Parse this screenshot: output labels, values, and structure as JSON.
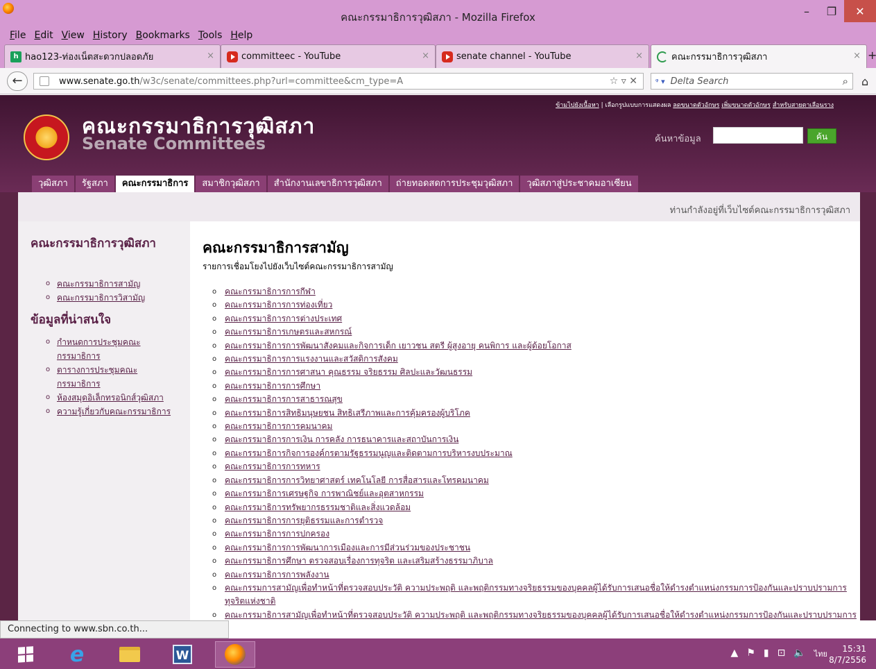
{
  "window": {
    "title": "คณะกรรมาธิการวุฒิสภา - Mozilla Firefox",
    "minimize": "–",
    "restore": "❐",
    "close": "✕"
  },
  "menu": [
    "File",
    "Edit",
    "View",
    "History",
    "Bookmarks",
    "Tools",
    "Help"
  ],
  "tabs": [
    {
      "label": "hao123-ท่องเน็ตสะดวกปลอดภัย",
      "icon": "hao123-icon",
      "close": "×"
    },
    {
      "label": "committeec - YouTube",
      "icon": "youtube-icon",
      "close": "×"
    },
    {
      "label": "senate channel - YouTube",
      "icon": "youtube-icon",
      "close": "×"
    },
    {
      "label": "คณะกรรมาธิการวุฒิสภา",
      "icon": "loading-icon",
      "close": "×"
    }
  ],
  "new_tab": "+",
  "nav": {
    "back": "←",
    "url_host": "www.senate.go.th",
    "url_path": "/w3c/senate/committees.php?url=committee&cm_type=A",
    "url_controls": "☆ ▿ ✕",
    "search_engine": "ᵠ ▾",
    "search_placeholder": "Delta Search",
    "search_go": "⌕",
    "home": "⌂"
  },
  "site": {
    "title_th": "คณะกรรมาธิการวุฒิสภา",
    "title_en": "Senate Committees",
    "top_links_sep": "|",
    "top_links": [
      "ข้ามไปยังเนื้อหา",
      "เลือกรูปแบบการแสดงผล",
      "ลดขนาดตัวอักษร",
      "เพิ่มขนาดตัวอักษร",
      "สำหรับสายตาเลือนราง"
    ],
    "search_label": "ค้นหาข้อมูล",
    "search_button": "ค้น",
    "nav": [
      {
        "label": "วุฒิสภา",
        "active": false
      },
      {
        "label": "รัฐสภา",
        "active": false
      },
      {
        "label": "คณะกรรมาธิการ",
        "active": true
      },
      {
        "label": "สมาชิกวุฒิสภา",
        "active": false
      },
      {
        "label": "สำนักงานเลขาธิการวุฒิสภา",
        "active": false
      },
      {
        "label": "ถ่ายทอดสดการประชุมวุฒิสภา",
        "active": false
      },
      {
        "label": "วุฒิสภาสู่ประชาคมอาเซียน",
        "active": false
      }
    ],
    "breadcrumb": "ท่านกำลังอยู่ที่เว็บไซต์คณะกรรมาธิการวุฒิสภา"
  },
  "sidebar": {
    "title": "คณะกรรมาธิการวุฒิสภา",
    "links": [
      "คณะกรรมาธิการสามัญ",
      "คณะกรรมาธิการวิสามัญ"
    ],
    "heading": "ข้อมูลที่น่าสนใจ",
    "info_links": [
      "กำหนดการประชุมคณะกรรมาธิการ",
      "ตารางการประชุมคณะกรรมาธิการ",
      "ห้องสมุดอิเล็กทรอนิกส์วุฒิสภา",
      "ความรู้เกี่ยวกับคณะกรรมาธิการ"
    ]
  },
  "main": {
    "heading": "คณะกรรมาธิการสามัญ",
    "subheading": "รายการเชื่อมโยงไปยังเว็บไซต์คณะกรรมาธิการสามัญ",
    "committees": [
      "คณะกรรมาธิการการกีฬา",
      "คณะกรรมาธิการการท่องเที่ยว",
      "คณะกรรมาธิการการต่างประเทศ",
      "คณะกรรมาธิการเกษตรและสหกรณ์",
      "คณะกรรมาธิการการพัฒนาสังคมและกิจการเด็ก เยาวชน สตรี ผู้สูงอายุ คนพิการ และผู้ด้อยโอกาส",
      "คณะกรรมาธิการการแรงงานและสวัสดิการสังคม",
      "คณะกรรมาธิการการศาสนา คุณธรรม จริยธรรม ศิลปะและวัฒนธรรม",
      "คณะกรรมาธิการการศึกษา",
      "คณะกรรมาธิการการสาธารณสุข",
      "คณะกรรมาธิการสิทธิมนุษยชน สิทธิเสรีภาพและการคุ้มครองผู้บริโภค",
      "คณะกรรมาธิการการคมนาคม",
      "คณะกรรมาธิการการเงิน การคลัง การธนาคารและสถาบันการเงิน",
      "คณะกรรมาธิการกิจการองค์กรตามรัฐธรรมนูญและติดตามการบริหารงบประมาณ",
      "คณะกรรมาธิการการทหาร",
      "คณะกรรมาธิการการวิทยาศาสตร์ เทคโนโลยี การสื่อสารและโทรคมนาคม",
      "คณะกรรมาธิการเศรษฐกิจ การพาณิชย์และอุตสาหกรรม",
      "คณะกรรมาธิการทรัพยากรธรรมชาติและสิ่งแวดล้อม",
      "คณะกรรมาธิการการยุติธรรมและการตำรวจ",
      "คณะกรรมาธิการการปกครอง",
      "คณะกรรมาธิการการพัฒนาการเมืองและการมีส่วนร่วมของประชาชน",
      "คณะกรรมาธิการศึกษา ตรวจสอบเรื่องการทุจริต และเสริมสร้างธรรมาภิบาล",
      "คณะกรรมาธิการการพลังงาน",
      "คณะกรรมการสามัญเพื่อทำหน้าที่ตรวจสอบประวัติ ความประพฤติ และพฤติกรรมทางจริยธรรมของบุคคลผู้ได้รับการเสนอชื่อให้ดำรงตำแหน่งกรรมการป้องกันและปราบปรามการทุจริตแห่งชาติ",
      "คณะกรรมาธิการสามัญเพื่อทำหน้าที่ตรวจสอบประวัติ ความประพฤติ และพฤติกรรมทางจริยธรรมของบุคคลผู้ได้รับการเสนอชื่อให้ดำรงตำแหน่งกรรมการป้องกันและปราบปรามการทุจริตแห่งชาติ"
    ]
  },
  "status": "Connecting to www.sbn.co.th...",
  "taskbar": {
    "apps": [
      "start-button",
      "internet-explorer-icon",
      "file-explorer-icon",
      "word-icon",
      "firefox-icon"
    ],
    "word_letter": "W",
    "ie_letter": "e",
    "tray": [
      "▲",
      "⚑",
      "▮",
      "⊡",
      "🔈"
    ],
    "lang": "ไทย",
    "time": "15:31",
    "date": "8/7/2556"
  }
}
